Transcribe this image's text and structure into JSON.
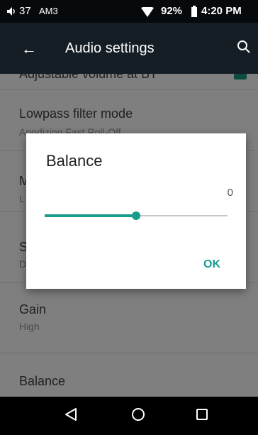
{
  "status_bar": {
    "volume": "37",
    "volume_icon": "speaker-icon",
    "audio_mode": "AM3",
    "battery": "92%",
    "time": "4:20 PM"
  },
  "toolbar": {
    "title": "Audio settings",
    "back_icon": "back-arrow-icon",
    "search_icon": "search-icon"
  },
  "settings": [
    {
      "title": "Adjustable volume at BT",
      "toggle": true
    },
    {
      "title": "Lowpass filter mode",
      "summary": "Apodizing Fast Roll-Off"
    },
    {
      "title": "M",
      "summary": "L"
    },
    {
      "title": "S",
      "summary": "D"
    },
    {
      "title": "Gain",
      "summary": "High"
    },
    {
      "title": "Balance"
    }
  ],
  "dialog": {
    "title": "Balance",
    "value": "0",
    "slider_position": 0.5,
    "ok_label": "OK"
  },
  "colors": {
    "accent": "#189d8c",
    "toolbar": "#151e24",
    "scrim_gray": "#7f7f7f"
  }
}
